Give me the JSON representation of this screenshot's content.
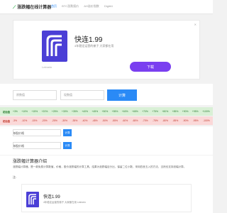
{
  "header": {
    "logo_text": "涨跌幅在线计算器",
    "nav": [
      "首页",
      "BTC涨跌报价",
      "AH溢价指数",
      "DigitAI"
    ]
  },
  "ad": {
    "title": "快连1.99",
    "subtitle": "4年稳定运营的梯子 大家都在用",
    "brand": "Letmein",
    "button": "下载",
    "close": "✕",
    "brand_color": "#7a3ff0"
  },
  "calculator": {
    "start_placeholder": "原数值",
    "current_placeholder": "现数值",
    "button": "计算"
  },
  "table": {
    "up_label": "初始值",
    "down_label": "初始值",
    "up_values": [
      "+3%",
      "+10%",
      "+15%",
      "+20%",
      "+25%",
      "+30%",
      "+35%",
      "+40%",
      "+45%",
      "+50%",
      "+55%",
      "+60%",
      "+65%",
      "+70%",
      "+75%",
      "+80%",
      "+85%",
      "+90%",
      "+95%",
      "+100%"
    ],
    "down_values": [
      "-3%",
      "-10%",
      "-15%",
      "-20%",
      "-25%",
      "-30%",
      "-35%",
      "-40%",
      "-45%",
      "-50%",
      "-55%",
      "-60%",
      "-65%",
      "-70%",
      "-75%",
      "-80%",
      "-85%",
      "-90%",
      "-95%",
      "-100%"
    ]
  },
  "mini": {
    "row1_label": "每股价格",
    "row1_button": "计算",
    "row2_label": "每股价格",
    "row2_button": "计算"
  },
  "intro": {
    "title": "涨跌幅计算器介绍",
    "text": "涨跌幅计算器，是一款免费计算数值，价格，股价涨跌幅的计算工具。结果为涨跌幅百分比，保留二位小数，采用四舍五入的方法，当然也支持涨幅计算。",
    "note": "注:"
  },
  "ad2": {
    "title": "快连1.99",
    "subtitle": "4年稳定运营的梯子 大家都在用 Letmein"
  }
}
